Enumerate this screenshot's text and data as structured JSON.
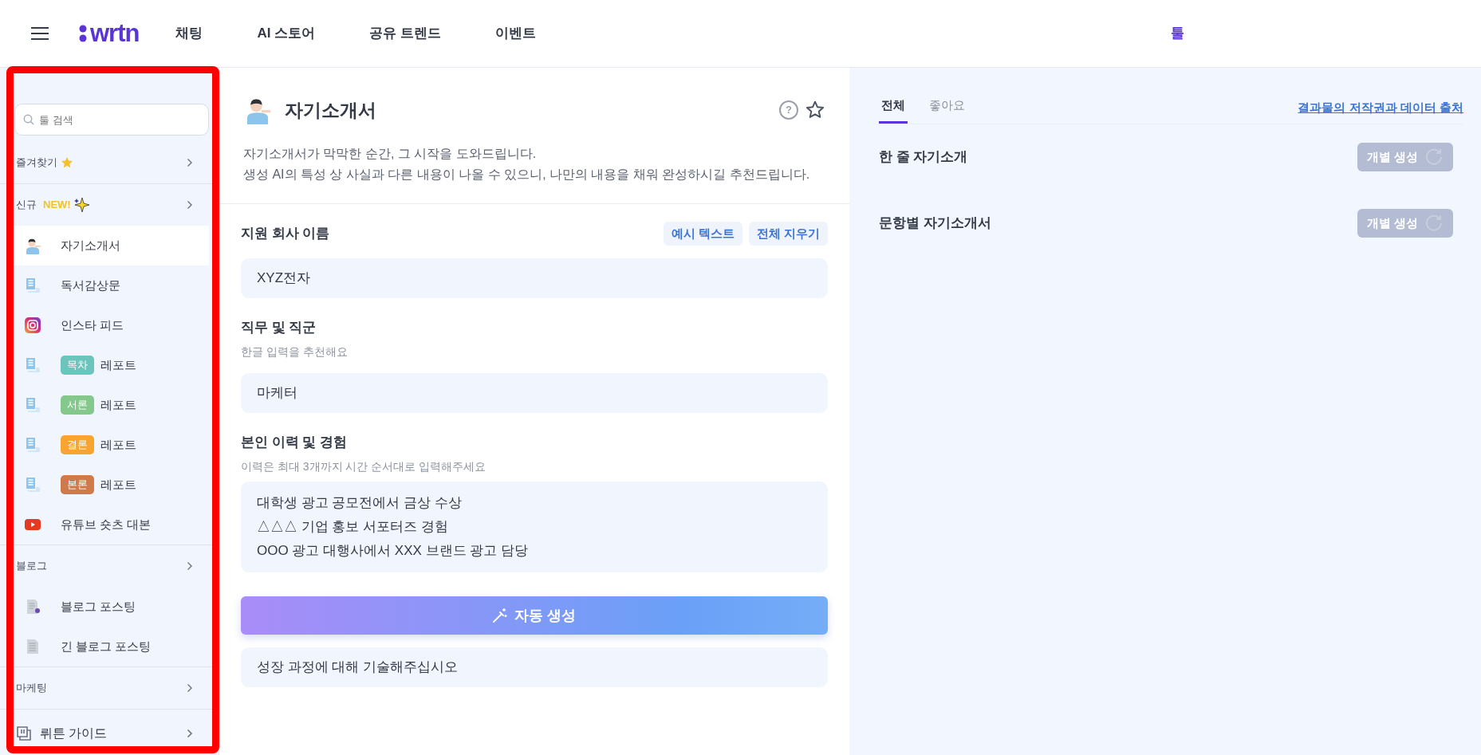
{
  "nav": {
    "brand": "wrtn",
    "items": [
      {
        "label": "채팅"
      },
      {
        "label": "AI 스토어"
      },
      {
        "label": "공유 트렌드"
      },
      {
        "label": "이벤트"
      }
    ],
    "right_item": "툴"
  },
  "sidebar": {
    "search": {
      "placeholder": "툴 검색"
    },
    "groups": [
      {
        "title": "즐겨찾기",
        "kind": "star"
      },
      {
        "title": "신규",
        "tag": "NEW!",
        "kind": "sparkle",
        "items": [
          {
            "label": "자기소개서",
            "kind": "person",
            "selected": true
          },
          {
            "label": "독서감상문",
            "kind": "document",
            "selected": false
          },
          {
            "label": "인스타 피드",
            "kind": "instagram",
            "selected": false
          },
          {
            "label": "레포트",
            "tag": "목차",
            "color": "#6cc5bd",
            "kind": "document",
            "selected": false
          },
          {
            "label": "레포트",
            "tag": "서론",
            "color": "#84c98b",
            "kind": "document",
            "selected": false
          },
          {
            "label": "레포트",
            "tag": "결론",
            "color": "#f6a531",
            "kind": "document",
            "selected": false
          },
          {
            "label": "레포트",
            "tag": "본론",
            "color": "#d07a4a",
            "kind": "document",
            "selected": false
          },
          {
            "label": "유튜브 숏츠 대본",
            "kind": "youtube",
            "selected": false
          }
        ]
      },
      {
        "title": "블로그",
        "kind": "plain",
        "items": [
          {
            "label": "블로그 포스팅",
            "kind": "blog",
            "selected": false
          },
          {
            "label": "긴 블로그 포스팅",
            "kind": "page",
            "selected": false
          }
        ]
      },
      {
        "title": "마케팅",
        "kind": "plain"
      }
    ],
    "footer": {
      "label": "뤼튼 가이드"
    }
  },
  "tool": {
    "title": "자기소개서",
    "help": "?",
    "favorite": false,
    "description": [
      "자기소개서가 막막한 순간, 그 시작을 도와드립니다.",
      "생성 AI의 특성 상 사실과 다른 내용이 나올 수 있으니, 나만의 내용을 채워 완성하시길 추천드립니다."
    ],
    "fields": [
      {
        "label": "지원 회사 이름",
        "actions": [
          "예시 텍스트",
          "전체 지우기"
        ],
        "value": "XYZ전자",
        "kind": "input"
      },
      {
        "label": "직무 및 직군",
        "hint": "한글 입력을 추천해요",
        "value": "마케터",
        "kind": "input"
      },
      {
        "label": "본인 이력 및 경험",
        "hint": "이력은 최대 3개까지 시간 순서대로 입력해주세요",
        "value": "대학생 광고 공모전에서 금상 수상\n△△△ 기업 홍보 서포터즈 경험\nOOO 광고 대행사에서 XXX 브랜드 광고 담당",
        "kind": "textarea"
      }
    ],
    "generate_button": "자동 생성",
    "next_field": {
      "value": "성장 과정에 대해 기술해주십시오"
    }
  },
  "results": {
    "tabs": [
      {
        "label": "전체",
        "selected": true
      },
      {
        "label": "좋아요",
        "selected": false
      }
    ],
    "link": "결과물의 저작권과 데이터 출처",
    "outputs": [
      {
        "title": "한 줄 자기소개",
        "button": "개별 생성",
        "disabled": true
      },
      {
        "title": "문항별 자기소개서",
        "button": "개별 생성",
        "disabled": true
      }
    ]
  }
}
